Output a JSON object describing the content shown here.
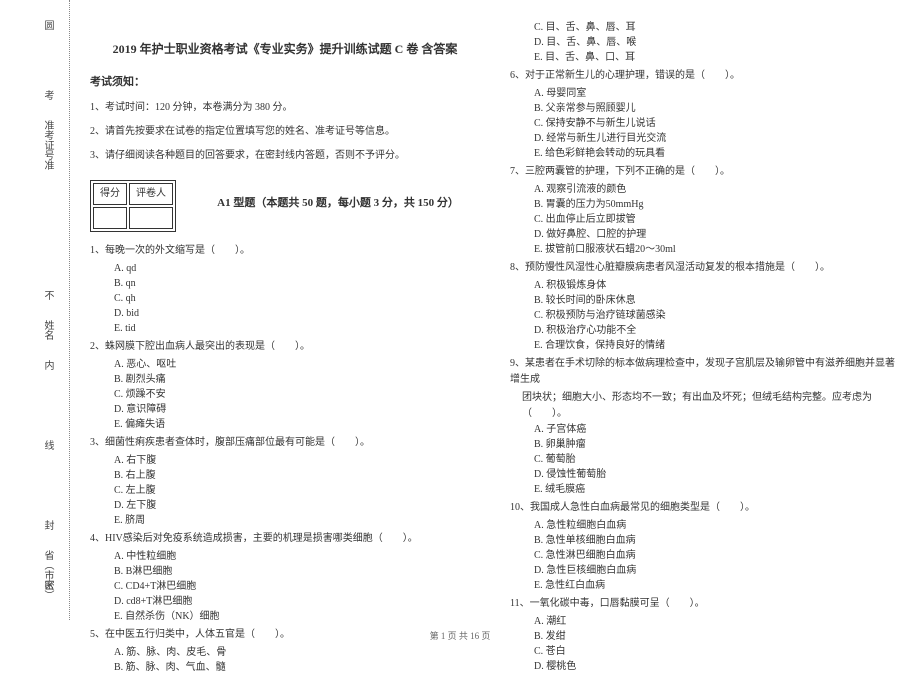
{
  "binding": {
    "t1": "圆",
    "t2": "考",
    "t3": "准",
    "t4": "不",
    "t5": "内",
    "t6": "线",
    "t7": "封",
    "t8": "密",
    "label_id": "准考证号",
    "label_name": "姓名",
    "label_region": "省（市区）"
  },
  "title": "2019 年护士职业资格考试《专业实务》提升训练试题 C 卷  含答案",
  "notice_head": "考试须知：",
  "notices": [
    "1、考试时间：120 分钟，本卷满分为 380 分。",
    "2、请首先按要求在试卷的指定位置填写您的姓名、准考证号等信息。",
    "3、请仔细阅读各种题目的回答要求，在密封线内答题，否则不予评分。"
  ],
  "score": {
    "c1": "得分",
    "c2": "评卷人"
  },
  "section_a1": "A1 型题（本题共 50 题，每小题 3 分，共 150 分）",
  "q1": {
    "stem": "1、每晚一次的外文缩写是（　　）。",
    "a": "A. qd",
    "b": "B. qn",
    "c": "C. qh",
    "d": "D. bid",
    "e": "E. tid"
  },
  "q2": {
    "stem": "2、蛛网膜下腔出血病人最突出的表现是（　　）。",
    "a": "A. 恶心、呕吐",
    "b": "B. 剧烈头痛",
    "c": "C. 烦躁不安",
    "d": "D. 意识障碍",
    "e": "E. 偏瘫失语"
  },
  "q3": {
    "stem": "3、细菌性痢疾患者查体时，腹部压痛部位最有可能是（　　）。",
    "a": "A. 右下腹",
    "b": "B. 右上腹",
    "c": "C. 左上腹",
    "d": "D. 左下腹",
    "e": "E. 脐周"
  },
  "q4": {
    "stem": "4、HIV感染后对免疫系统造成损害，主要的机理是损害哪类细胞（　　）。",
    "a": "A. 中性粒细胞",
    "b": "B. B淋巴细胞",
    "c": "C. CD4+T淋巴细胞",
    "d": "D. cd8+T淋巴细胞",
    "e": "E. 自然杀伤（NK）细胞"
  },
  "q5": {
    "stem": "5、在中医五行归类中，人体五官是（　　）。",
    "a": "A. 筋、脉、肉、皮毛、骨",
    "b": "B. 筋、脉、肉、气血、髓"
  },
  "q5_more": {
    "c": "C. 目、舌、鼻、唇、耳",
    "d": "D. 目、舌、鼻、唇、喉",
    "e": "E. 目、舌、鼻、口、耳"
  },
  "q6": {
    "stem": "6、对于正常新生儿的心理护理，错误的是（　　）。",
    "a": "A. 母婴同室",
    "b": "B. 父亲常参与照顾婴儿",
    "c": "C. 保持安静不与新生儿说话",
    "d": "D. 经常与新生儿进行目光交流",
    "e": "E. 给色彩鲜艳会转动的玩具看"
  },
  "q7": {
    "stem": "7、三腔两囊管的护理，下列不正确的是（　　）。",
    "a": "A. 观察引流液的颜色",
    "b": "B. 胃囊的压力为50mmHg",
    "c": "C. 出血停止后立即拔管",
    "d": "D. 做好鼻腔、口腔的护理",
    "e": "E. 拔管前口服液状石蜡20～30ml"
  },
  "q8": {
    "stem": "8、预防慢性风湿性心脏瓣膜病患者风湿活动复发的根本措施是（　　）。",
    "a": "A. 积极锻炼身体",
    "b": "B. 较长时间的卧床休息",
    "c": "C. 积极预防与治疗链球菌感染",
    "d": "D. 积极治疗心功能不全",
    "e": "E. 合理饮食，保持良好的情绪"
  },
  "q9": {
    "stem": "9、某患者在手术切除的标本做病理检查中，发现子宫肌层及输卵管中有滋养细胞并显著增生成",
    "cont": "团块状；细胞大小、形态均不一致；有出血及坏死；但绒毛结构完整。应考虑为（　　）。",
    "a": "A. 子宫体癌",
    "b": "B. 卵巢肿瘤",
    "c": "C. 葡萄胎",
    "d": "D. 侵蚀性葡萄胎",
    "e": "E. 绒毛膜癌"
  },
  "q10": {
    "stem": "10、我国成人急性白血病最常见的细胞类型是（　　）。",
    "a": "A. 急性粒细胞白血病",
    "b": "B. 急性单核细胞白血病",
    "c": "C. 急性淋巴细胞白血病",
    "d": "D. 急性巨核细胞白血病",
    "e": "E. 急性红白血病"
  },
  "q11": {
    "stem": "11、一氧化碳中毒，口唇黏膜可呈（　　）。",
    "a": "A. 潮红",
    "b": "B. 发绀",
    "c": "C. 苍白",
    "d": "D. 樱桃色"
  },
  "footer": "第 1 页 共 16 页"
}
